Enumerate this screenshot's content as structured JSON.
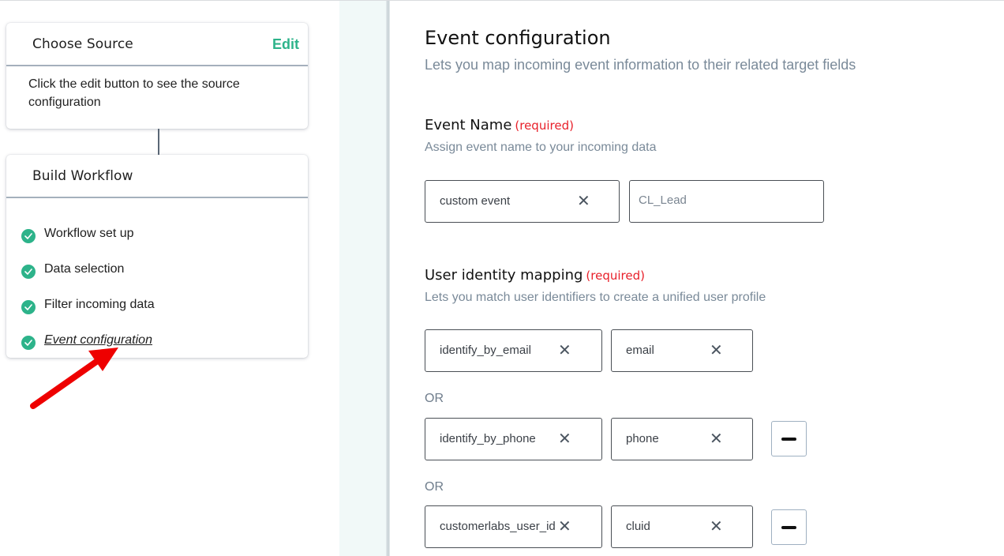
{
  "sidebar": {
    "choose_source": {
      "title": "Choose Source",
      "edit_label": "Edit",
      "description": "Click the edit button to see the source configuration"
    },
    "build_workflow": {
      "title": "Build Workflow",
      "steps": [
        {
          "label": "Workflow set up",
          "status": "complete",
          "icon": "check-circle-icon"
        },
        {
          "label": "Data selection",
          "status": "complete",
          "icon": "check-circle-icon"
        },
        {
          "label": "Filter incoming data",
          "status": "complete",
          "icon": "check-circle-icon"
        },
        {
          "label": "Event configuration",
          "status": "complete",
          "icon": "check-circle-icon",
          "active": true
        }
      ]
    },
    "annotation": "red-arrow-pointing-to-event-configuration"
  },
  "main": {
    "title": "Event configuration",
    "subtitle": "Lets you map incoming event information to their related target fields",
    "event_name": {
      "title": "Event Name",
      "required_label": "(required)",
      "description": "Assign event name to your incoming data",
      "type_value": "custom event",
      "name_value": "CL_Lead"
    },
    "user_identity": {
      "title": "User identity mapping",
      "required_label": "(required)",
      "description": "Lets you match user identifiers to create a unified user profile",
      "or_label": "OR",
      "mappings": [
        {
          "identifier": "identify_by_email",
          "field": "email",
          "removable": false
        },
        {
          "identifier": "identify_by_phone",
          "field": "phone",
          "removable": true
        },
        {
          "identifier": "customerlabs_user_id",
          "field": "cluid",
          "removable": true
        }
      ]
    },
    "clear_glyph": "✕"
  },
  "colors": {
    "accent": "#2db38a",
    "required": "#e8202a",
    "muted_text": "#7a8a99",
    "strip": "#f1f9f8"
  }
}
